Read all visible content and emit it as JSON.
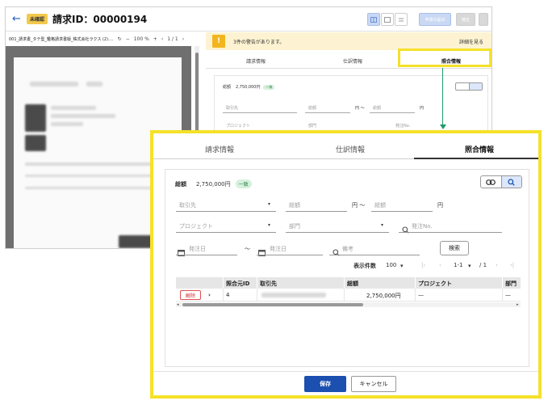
{
  "header": {
    "status_badge": "未確認",
    "title": "請求ID：00000194",
    "submit_label": "申請の提出",
    "confirm_label": "確定"
  },
  "pdf": {
    "filename": "001_請求書_タテ型_鑑格請求書版_株式会社ラクス (2).…",
    "zoom": "100 %",
    "page": "1 / 1"
  },
  "warning": {
    "text": "3件の警告があります。",
    "link": "詳細を見る"
  },
  "tabs": [
    "請求情報",
    "仕訳情報",
    "照合情報"
  ],
  "active_tab_index": 2,
  "match": {
    "total_label": "総額",
    "total_value": "2,750,000円",
    "match_badge": "一致",
    "vendor_placeholder": "取引先",
    "amount_from_placeholder": "総額",
    "yen_tilde": "円 〜",
    "amount_to_placeholder": "総額",
    "yen": "円",
    "project_placeholder": "プロジェクト",
    "dept_placeholder": "部門",
    "order_no_placeholder": "発注No.",
    "order_date_from_placeholder": "発注日",
    "tilde": "〜",
    "order_date_to_placeholder": "発注日",
    "memo_placeholder": "備考",
    "search_button": "検索",
    "page_size_label": "表示件数",
    "page_size_value": "100",
    "range": "1-1",
    "of_total": "/ 1",
    "table": {
      "columns": [
        "照合元ID",
        "取引先",
        "総額",
        "プロジェクト",
        "部門"
      ],
      "rows": [
        {
          "release_label": "解除",
          "expand": "›",
          "id": "4",
          "vendor": "",
          "amount": "2,750,000円",
          "project": "—",
          "dept": "—"
        }
      ]
    }
  },
  "footer": {
    "save_label": "保存",
    "cancel_label": "キャンセル"
  },
  "colors": {
    "highlight": "#f5e12a",
    "primary": "#1b4fb0",
    "match_badge": "#d6f0de",
    "warning_bg": "#fdf3d2",
    "arrow": "#1f9a6a"
  }
}
